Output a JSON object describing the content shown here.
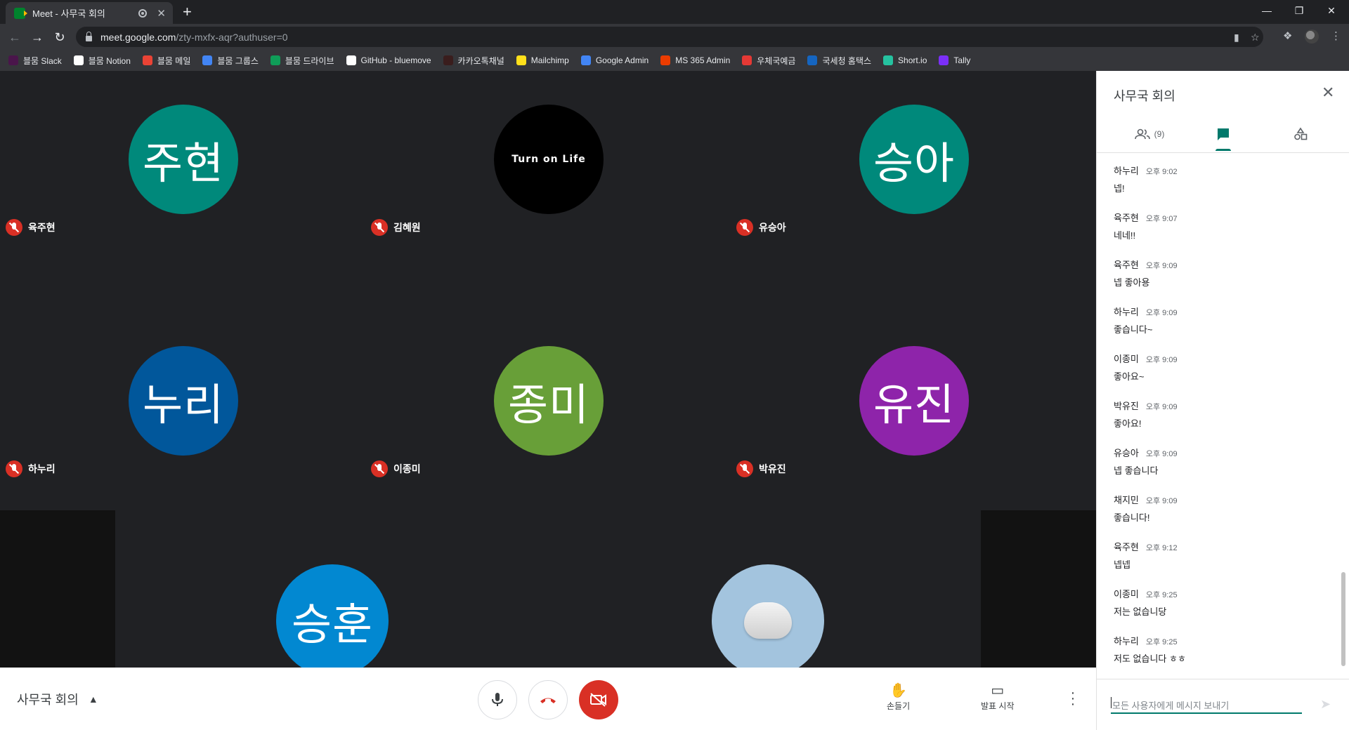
{
  "browser": {
    "tab_title": "Meet - 사무국 회의",
    "tab_close": "✕",
    "new_tab": "+",
    "url_host": "meet.google.com",
    "url_path": "/zty-mxfx-aqr?authuser=0"
  },
  "bookmarks": [
    {
      "label": "블뭄 Slack",
      "color": "#4a154b"
    },
    {
      "label": "블뭄 Notion",
      "color": "#ffffff"
    },
    {
      "label": "블뭄 메일",
      "color": "#ea4335"
    },
    {
      "label": "블뭄 그룹스",
      "color": "#4285f4"
    },
    {
      "label": "블뭄 드라이브",
      "color": "#0f9d58"
    },
    {
      "label": "GitHub - bluemove",
      "color": "#ffffff"
    },
    {
      "label": "카카오톡채널",
      "color": "#3a1d1d"
    },
    {
      "label": "Mailchimp",
      "color": "#ffe01b"
    },
    {
      "label": "Google Admin",
      "color": "#4285f4"
    },
    {
      "label": "MS 365 Admin",
      "color": "#eb3c00"
    },
    {
      "label": "우체국예금",
      "color": "#e53935"
    },
    {
      "label": "국세청 홈택스",
      "color": "#1565c0"
    },
    {
      "label": "Short.io",
      "color": "#25c2a0"
    },
    {
      "label": "Tally",
      "color": "#7b2ff7"
    }
  ],
  "participants": [
    {
      "name": "육주현",
      "avatar_text": "주현",
      "color": "#00897b",
      "muted": true
    },
    {
      "name": "김혜원",
      "avatar_text": "Turn on Life",
      "color": "#000000",
      "muted": true
    },
    {
      "name": "유승아",
      "avatar_text": "승아",
      "color": "#00897b",
      "muted": true
    },
    {
      "name": "하누리",
      "avatar_text": "누리",
      "color": "#01579b",
      "muted": true
    },
    {
      "name": "이종미",
      "avatar_text": "종미",
      "color": "#689f38",
      "muted": true
    },
    {
      "name": "박유진",
      "avatar_text": "유진",
      "color": "#8e24aa",
      "muted": true
    },
    {
      "name": "",
      "avatar_text": "승훈",
      "color": "#0288d1",
      "muted": false
    },
    {
      "name": "",
      "avatar_text": "",
      "color": "#a3c4de",
      "muted": false
    }
  ],
  "controls": {
    "meeting_name": "사무국 회의",
    "raise_hand": "손들기",
    "present": "발표 시작"
  },
  "panel": {
    "title": "사무국 회의",
    "participants_count": "(9)",
    "messages": [
      {
        "sender": "하누리",
        "time": "오후 9:02",
        "text": "넵!"
      },
      {
        "sender": "육주현",
        "time": "오후 9:07",
        "text": "네네!!"
      },
      {
        "sender": "육주현",
        "time": "오후 9:09",
        "text": "넵 좋아용"
      },
      {
        "sender": "하누리",
        "time": "오후 9:09",
        "text": "좋습니다~"
      },
      {
        "sender": "이종미",
        "time": "오후 9:09",
        "text": "좋아요~"
      },
      {
        "sender": "박유진",
        "time": "오후 9:09",
        "text": "좋아요!"
      },
      {
        "sender": "유승아",
        "time": "오후 9:09",
        "text": "넵 좋습니다"
      },
      {
        "sender": "채지민",
        "time": "오후 9:09",
        "text": "좋습니다!"
      },
      {
        "sender": "육주현",
        "time": "오후 9:12",
        "text": "넵넵"
      },
      {
        "sender": "이종미",
        "time": "오후 9:25",
        "text": "저는 없습니당"
      },
      {
        "sender": "하누리",
        "time": "오후 9:25",
        "text": "저도 없습니다 ㅎㅎ"
      }
    ],
    "composer_placeholder": "모든 사용자에게 메시지 보내기"
  }
}
